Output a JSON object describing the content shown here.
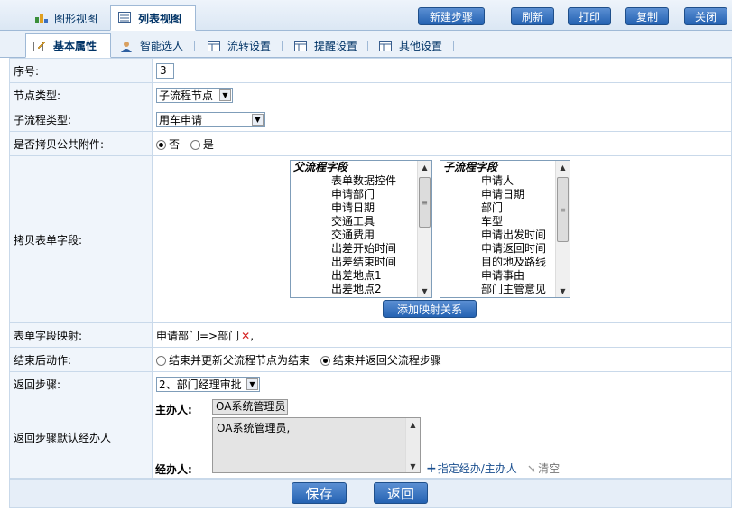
{
  "view_tabs": [
    {
      "label": "图形视图",
      "icon": "chart-icon"
    },
    {
      "label": "列表视图",
      "icon": "list-icon"
    }
  ],
  "toolbar": {
    "new_step": "新建步骤",
    "refresh": "刷新",
    "print": "打印",
    "copy": "复制",
    "close": "关闭"
  },
  "sub_tabs": [
    {
      "label": "基本属性",
      "icon": "edit-icon"
    },
    {
      "label": "智能选人",
      "icon": "user-icon"
    },
    {
      "label": "流转设置",
      "icon": "table-icon"
    },
    {
      "label": "提醒设置",
      "icon": "table-icon"
    },
    {
      "label": "其他设置",
      "icon": "table-icon"
    }
  ],
  "form": {
    "seq_label": "序号:",
    "seq_value": "3",
    "node_type_label": "节点类型:",
    "node_type_value": "子流程节点",
    "sub_type_label": "子流程类型:",
    "sub_type_value": "用车申请",
    "copy_attach_label": "是否拷贝公共附件:",
    "copy_attach_no": "否",
    "copy_attach_yes": "是",
    "copy_fields_label": "拷贝表单字段:",
    "parent_fields": [
      "父流程字段",
      "表单数据控件",
      "申请部门",
      "申请日期",
      "交通工具",
      "交通费用",
      "出差开始时间",
      "出差结束时间",
      "出差地点1",
      "出差地点2"
    ],
    "child_fields": [
      "子流程字段",
      "申请人",
      "申请日期",
      "部门",
      "车型",
      "申请出发时间",
      "申请返回时间",
      "目的地及路线",
      "申请事由",
      "部门主管意见"
    ],
    "add_mapping": "添加映射关系",
    "mapping_label": "表单字段映射:",
    "mapping_value": "申请部门=>部门",
    "mapping_sep": ",",
    "end_action_label": "结束后动作:",
    "end_action_opt1": "结束并更新父流程节点为结束",
    "end_action_opt2": "结束并返回父流程步骤",
    "return_step_label": "返回步骤:",
    "return_step_value": "2、部门经理审批",
    "default_handler_label": "返回步骤默认经办人",
    "host_label": "主办人:",
    "host_value": "OA系统管理员",
    "handler_label": "经办人:",
    "handler_value": "OA系统管理员,",
    "assign_link": "指定经办/主办人",
    "clear_link": "清空"
  },
  "footer": {
    "save": "保存",
    "back": "返回"
  },
  "colors": {
    "accent": "#2462b2",
    "header_bg": "#dbe7f4",
    "label_bg": "#f0f5fb",
    "delete_x": "#d42020"
  }
}
